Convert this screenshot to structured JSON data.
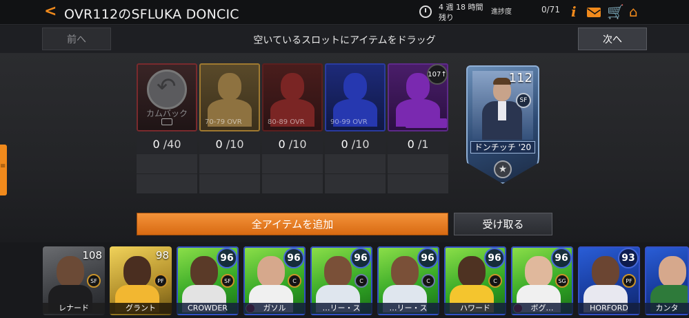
{
  "header": {
    "title": "OVR112のSFLUKA DONCIC",
    "timer_line1": "4 週 18 時間",
    "timer_line2": "残り",
    "progress_label": "進捗度",
    "progress_value": "0/71",
    "info_icon_glyph": "i",
    "cart_icon_glyph": "🛒",
    "home_icon_glyph": "⌂",
    "back_glyph": "<",
    "accent_color": "#f18a1c"
  },
  "subbar": {
    "prev_label": "前へ",
    "instruction": "空いているスロットにアイテムをドラッグ",
    "next_label": "次へ"
  },
  "slots": [
    {
      "name": "カムバック",
      "tier": "",
      "count": "0",
      "total": "/40",
      "color": "#7a2a2d"
    },
    {
      "name": "",
      "tier": "70-79 OVR",
      "count": "0",
      "total": "/10",
      "color": "#a07a30"
    },
    {
      "name": "",
      "tier": "80-89 OVR",
      "count": "0",
      "total": "/10",
      "color": "#5c1f1f"
    },
    {
      "name": "",
      "tier": "90-99 OVR",
      "count": "0",
      "total": "/10",
      "color": "#2a3ba0"
    },
    {
      "name": "",
      "tier": "",
      "badge": "107↑",
      "count": "0",
      "total": "/1",
      "color": "#5e2a8a"
    }
  ],
  "reward_card": {
    "ovr": "112",
    "position": "SF",
    "name": "ドンチッチ '20",
    "star_glyph": "★"
  },
  "actions": {
    "add_all_label": "全アイテムを追加",
    "receive_label": "受け取る"
  },
  "cards": [
    {
      "ovr": "108",
      "pos": "SF",
      "name": "レナード",
      "style": "gray"
    },
    {
      "ovr": "98",
      "pos": "PF",
      "name": "グラント",
      "style": "gold"
    },
    {
      "ovr": "96",
      "pos": "SF",
      "name": "CROWDER",
      "style": "green"
    },
    {
      "ovr": "96",
      "pos": "C",
      "name": "ガソル",
      "style": "green"
    },
    {
      "ovr": "96",
      "pos": "C",
      "name": "…リー・ス",
      "style": "green"
    },
    {
      "ovr": "96",
      "pos": "C",
      "name": "…リー・ス",
      "style": "green"
    },
    {
      "ovr": "96",
      "pos": "C",
      "name": "ハワード",
      "style": "green"
    },
    {
      "ovr": "96",
      "pos": "SG",
      "name": "ボグ…",
      "style": "green"
    },
    {
      "ovr": "93",
      "pos": "PF",
      "name": "HORFORD",
      "style": "blue"
    },
    {
      "ovr": "",
      "pos": "",
      "name": "カンタ",
      "style": "blue"
    }
  ]
}
